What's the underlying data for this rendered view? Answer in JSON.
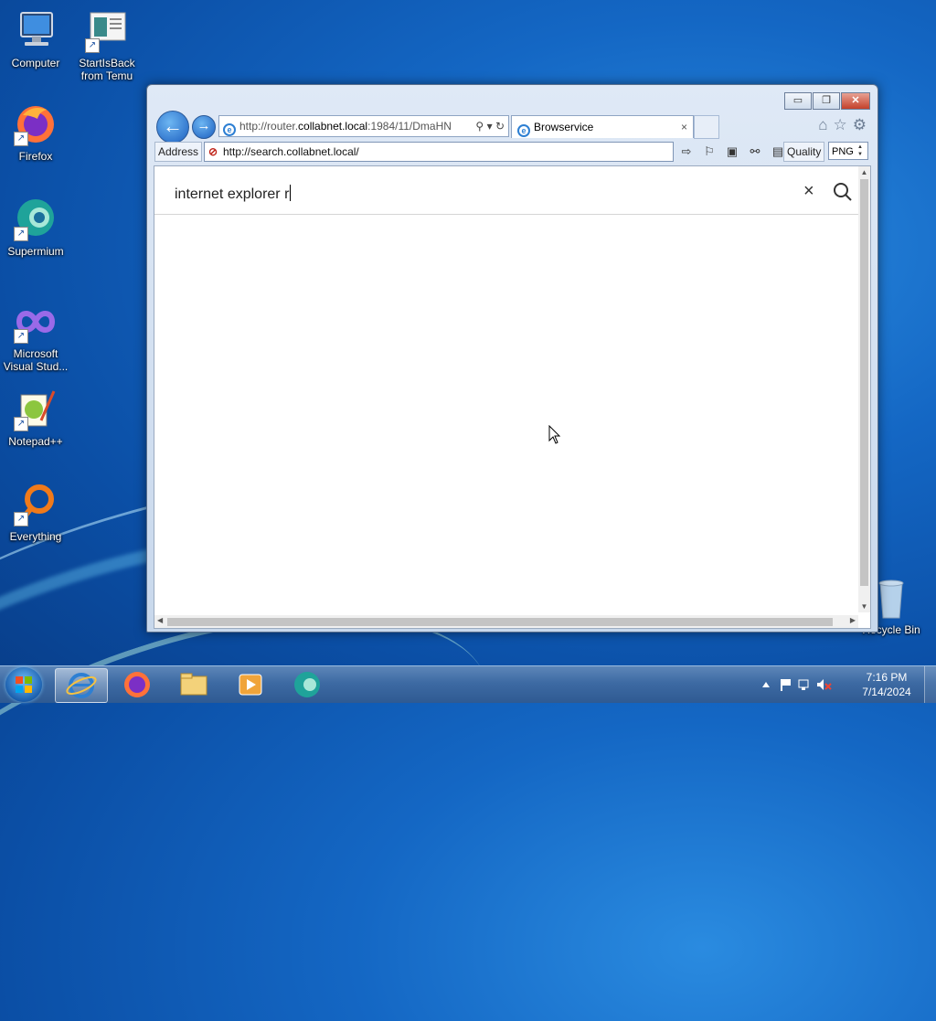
{
  "desktop": {
    "icons": [
      {
        "label": "Computer"
      },
      {
        "label": "StartIsBack from Temu"
      },
      {
        "label": "Firefox"
      },
      {
        "label": "Supermium"
      },
      {
        "label": "Microsoft Visual Stud..."
      },
      {
        "label": "Notepad++"
      },
      {
        "label": "Everything"
      },
      {
        "label": "Recycle Bin"
      }
    ]
  },
  "browser": {
    "url": {
      "prefix": "http://router.",
      "host": "collabnet.local",
      "suffix": ":1984/11/DmaHN"
    },
    "tab": {
      "title": "Browservice",
      "close": "×"
    },
    "address_label": "Address",
    "address_value": "http://search.collabnet.local/",
    "quality_label": "Quality",
    "quality_value": "PNG",
    "window_controls": {
      "minimize": "▭",
      "restore": "❐",
      "close": "✕"
    }
  },
  "page": {
    "search_query": "internet explorer r",
    "clear_symbol": "×"
  },
  "taskbar": {
    "clock_time": "7:16 PM",
    "clock_date": "7/14/2024"
  },
  "colors": {
    "accent": "#1c5fc0",
    "desktop": "#1467c4",
    "taskbar": "#3d6aa3"
  }
}
